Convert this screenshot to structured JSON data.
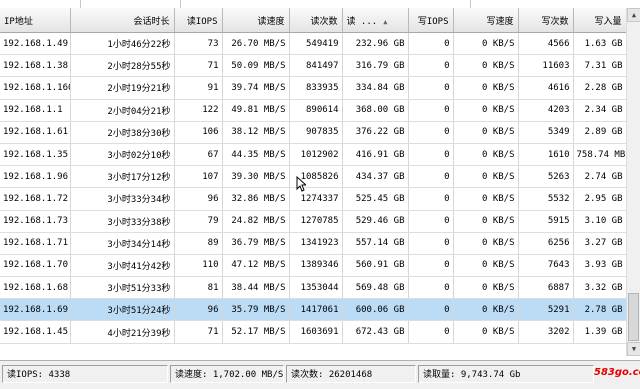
{
  "columns": [
    {
      "label": "IP地址",
      "sort": ""
    },
    {
      "label": "会话时长",
      "sort": ""
    },
    {
      "label": "读IOPS",
      "sort": ""
    },
    {
      "label": "读速度",
      "sort": ""
    },
    {
      "label": "读次数",
      "sort": ""
    },
    {
      "label": "读 ...",
      "sort": "▲"
    },
    {
      "label": "写IOPS",
      "sort": ""
    },
    {
      "label": "写速度",
      "sort": ""
    },
    {
      "label": "写次数",
      "sort": ""
    },
    {
      "label": "写入量",
      "sort": ""
    }
  ],
  "rows": [
    [
      "192.168.1.49",
      "1小时46分22秒",
      "73",
      "26.70 MB/S",
      "549419",
      "232.96 GB",
      "0",
      "0 KB/S",
      "4566",
      "1.63 GB"
    ],
    [
      "192.168.1.38",
      "2小时28分55秒",
      "71",
      "50.09 MB/S",
      "841497",
      "316.79 GB",
      "0",
      "0 KB/S",
      "11603",
      "7.31 GB"
    ],
    [
      "192.168.1.160",
      "2小时19分21秒",
      "91",
      "39.74 MB/S",
      "833935",
      "334.84 GB",
      "0",
      "0 KB/S",
      "4616",
      "2.28 GB"
    ],
    [
      "192.168.1.1",
      "2小时04分21秒",
      "122",
      "49.81 MB/S",
      "890614",
      "368.00 GB",
      "0",
      "0 KB/S",
      "4203",
      "2.34 GB"
    ],
    [
      "192.168.1.61",
      "2小时38分30秒",
      "106",
      "38.12 MB/S",
      "907835",
      "376.22 GB",
      "0",
      "0 KB/S",
      "5349",
      "2.89 GB"
    ],
    [
      "192.168.1.35",
      "3小时02分10秒",
      "67",
      "44.35 MB/S",
      "1012902",
      "416.91 GB",
      "0",
      "0 KB/S",
      "1610",
      "758.74 MB"
    ],
    [
      "192.168.1.96",
      "3小时17分12秒",
      "107",
      "39.30 MB/S",
      "1085826",
      "434.37 GB",
      "0",
      "0 KB/S",
      "5263",
      "2.74 GB"
    ],
    [
      "192.168.1.72",
      "3小时33分34秒",
      "96",
      "32.86 MB/S",
      "1274337",
      "525.45 GB",
      "0",
      "0 KB/S",
      "5532",
      "2.95 GB"
    ],
    [
      "192.168.1.73",
      "3小时33分38秒",
      "79",
      "24.82 MB/S",
      "1270785",
      "529.46 GB",
      "0",
      "0 KB/S",
      "5915",
      "3.10 GB"
    ],
    [
      "192.168.1.71",
      "3小时34分14秒",
      "89",
      "36.79 MB/S",
      "1341923",
      "557.14 GB",
      "0",
      "0 KB/S",
      "6256",
      "3.27 GB"
    ],
    [
      "192.168.1.70",
      "3小时41分42秒",
      "110",
      "47.12 MB/S",
      "1389346",
      "560.91 GB",
      "0",
      "0 KB/S",
      "7643",
      "3.93 GB"
    ],
    [
      "192.168.1.68",
      "3小时51分33秒",
      "81",
      "38.44 MB/S",
      "1353044",
      "569.48 GB",
      "0",
      "0 KB/S",
      "6887",
      "3.32 GB"
    ],
    [
      "192.168.1.69",
      "3小时51分24秒",
      "96",
      "35.79 MB/S",
      "1417061",
      "600.06 GB",
      "0",
      "0 KB/S",
      "5291",
      "2.78 GB"
    ],
    [
      "192.168.1.45",
      "4小时21分39秒",
      "71",
      "52.17 MB/S",
      "1603691",
      "672.43 GB",
      "0",
      "0 KB/S",
      "3202",
      "1.39 GB"
    ]
  ],
  "selected_row": 12,
  "status": {
    "read_iops": "读IOPS: 4338",
    "read_speed": "读速度: 1,702.00 MB/S",
    "read_count": "读次数: 26201468",
    "read_volume": "读取量: 9,743.74 Gb"
  },
  "watermark": "583go.com",
  "colors": {
    "selected": "#bcdcf6",
    "header": "#eeeeee",
    "watermark": "#e60000"
  }
}
